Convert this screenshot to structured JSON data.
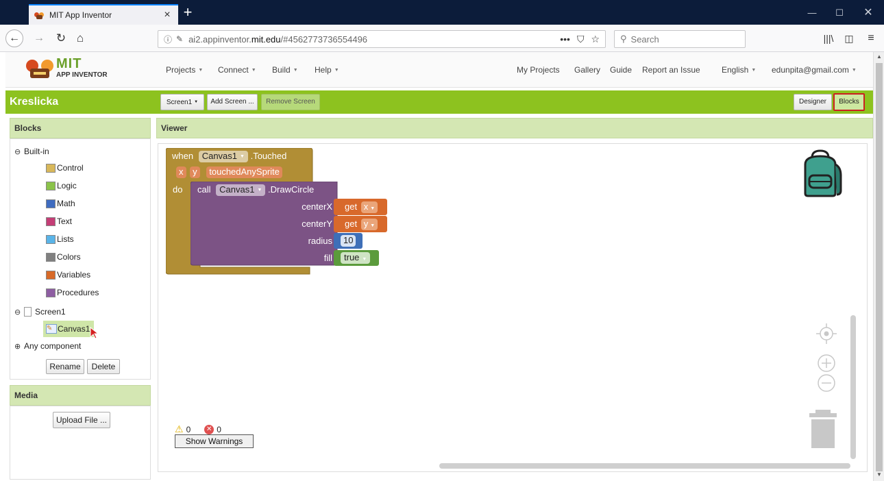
{
  "browser": {
    "tab_title": "MIT App Inventor",
    "tab_close": "×",
    "new_tab": "+",
    "url_host_prefix": "ai2.appinventor.",
    "url_host_main": "mit.edu",
    "url_path": "/#4562773736554496",
    "url_more": "•••",
    "search_placeholder": "Search"
  },
  "app": {
    "logo_text": "MIT",
    "logo_sub": "APP INVENTOR",
    "menu_left": [
      "Projects",
      "Connect",
      "Build",
      "Help"
    ],
    "menu_right": [
      "My Projects",
      "Gallery",
      "Guide",
      "Report an Issue",
      "English",
      "edunpita@gmail.com"
    ],
    "project_name": "Kreslicka",
    "screen_select": "Screen1",
    "add_screen": "Add Screen ...",
    "remove_screen": "Remove Screen",
    "designer": "Designer",
    "blocks": "Blocks"
  },
  "blocks_panel": {
    "title": "Blocks",
    "builtin_label": "Built-in",
    "builtin_items": [
      {
        "label": "Control",
        "color": "#d8b85a"
      },
      {
        "label": "Logic",
        "color": "#8bc34a"
      },
      {
        "label": "Math",
        "color": "#3f6cc0"
      },
      {
        "label": "Text",
        "color": "#c43e76"
      },
      {
        "label": "Lists",
        "color": "#5ab4e8"
      },
      {
        "label": "Colors",
        "color": "#808080"
      },
      {
        "label": "Variables",
        "color": "#d86a28"
      },
      {
        "label": "Procedures",
        "color": "#8e5ea2"
      }
    ],
    "screen_label": "Screen1",
    "canvas_label": "Canvas1",
    "any_component": "Any component",
    "rename": "Rename",
    "delete": "Delete"
  },
  "media_panel": {
    "title": "Media",
    "upload": "Upload File ..."
  },
  "viewer": {
    "title": "Viewer",
    "event": {
      "when": "when",
      "component": "Canvas1",
      "event_name": ".Touched",
      "params": [
        "x",
        "y",
        "touchedAnySprite"
      ],
      "do": "do"
    },
    "call": {
      "call": "call",
      "component": "Canvas1",
      "method": ".DrawCircle",
      "args": [
        {
          "name": "centerX",
          "get": "get",
          "var": "x"
        },
        {
          "name": "centerY",
          "get": "get",
          "var": "y"
        },
        {
          "name": "radius",
          "value": "10"
        },
        {
          "name": "fill",
          "value": "true"
        }
      ]
    },
    "warnings_count": "0",
    "errors_count": "0",
    "show_warnings": "Show Warnings"
  }
}
